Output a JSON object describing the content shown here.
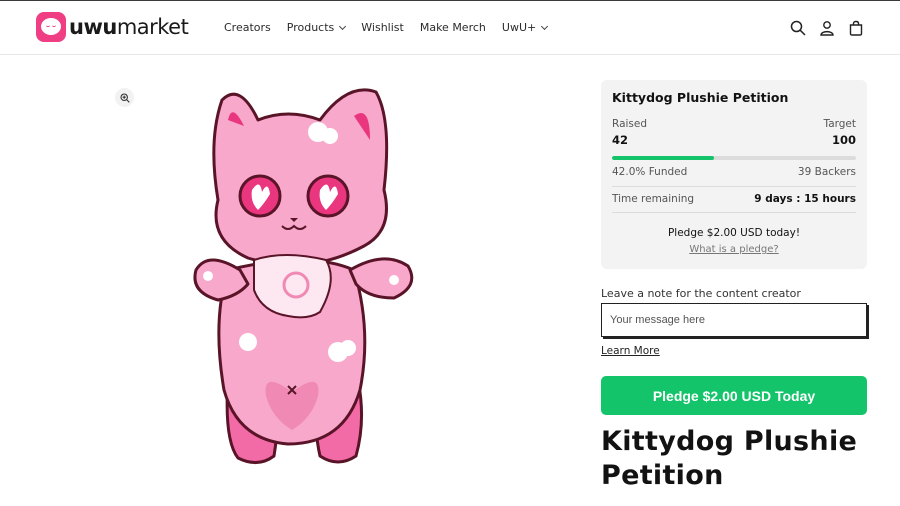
{
  "header": {
    "logo_text_bold": "uwu",
    "logo_text_regular": "market",
    "nav": [
      {
        "label": "Creators",
        "has_dropdown": false
      },
      {
        "label": "Products",
        "has_dropdown": true
      },
      {
        "label": "Wishlist",
        "has_dropdown": false
      },
      {
        "label": "Make Merch",
        "has_dropdown": false
      },
      {
        "label": "UwU+",
        "has_dropdown": true
      }
    ],
    "icons": [
      "search-icon",
      "account-icon",
      "cart-icon"
    ]
  },
  "campaign": {
    "title": "Kittydog Plushie Petition",
    "raised_label": "Raised",
    "raised_value": "42",
    "target_label": "Target",
    "target_value": "100",
    "progress_fraction": 0.42,
    "funded_text": "42.0% Funded",
    "backers_text": "39 Backers",
    "time_label": "Time remaining",
    "time_value": "9 days : 15 hours",
    "pledge_today": "Pledge $2.00 USD today!",
    "what_is_pledge": "What is a pledge?"
  },
  "note": {
    "label": "Leave a note for the content creator",
    "placeholder": "Your message here",
    "learn_more": "Learn More"
  },
  "pledge_button": "Pledge $2.00 USD Today",
  "product_title": "Kittydog Plushie Petition",
  "colors": {
    "brand_pink": "#ef3e83",
    "accent_green": "#14c46a"
  }
}
